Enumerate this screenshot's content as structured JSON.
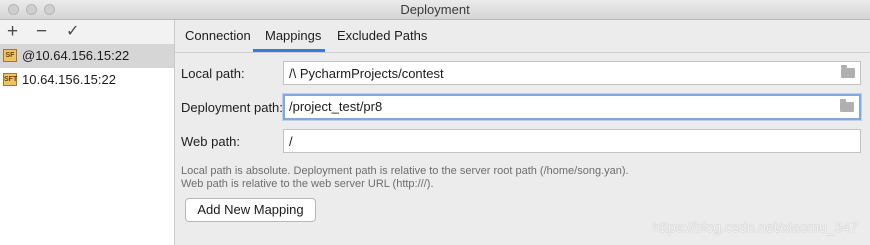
{
  "window": {
    "title": "Deployment"
  },
  "toolbar": {
    "add": "+",
    "remove": "−",
    "check": "✓"
  },
  "servers": [
    {
      "icon_text": "SF",
      "label": "@10.64.156.15:22"
    },
    {
      "icon_text": "SFT",
      "label": "10.64.156.15:22"
    }
  ],
  "tabs": [
    "Connection",
    "Mappings",
    "Excluded Paths"
  ],
  "form": {
    "local_path": {
      "label": "Local path:",
      "value": "/\\                 PycharmProjects/contest"
    },
    "deployment_path": {
      "label": "Deployment path:",
      "value": "/project_test/pr8"
    },
    "web_path": {
      "label": "Web path:",
      "value": "/"
    }
  },
  "hints": {
    "line1": "Local path is absolute. Deployment path is relative to the server root path (/home/song.yan).",
    "line2": "Web path is relative to the web server URL (http:///)."
  },
  "add_mapping_button": "Add New Mapping",
  "watermark": "https://blog.csdn.net/xiaomu_347"
}
